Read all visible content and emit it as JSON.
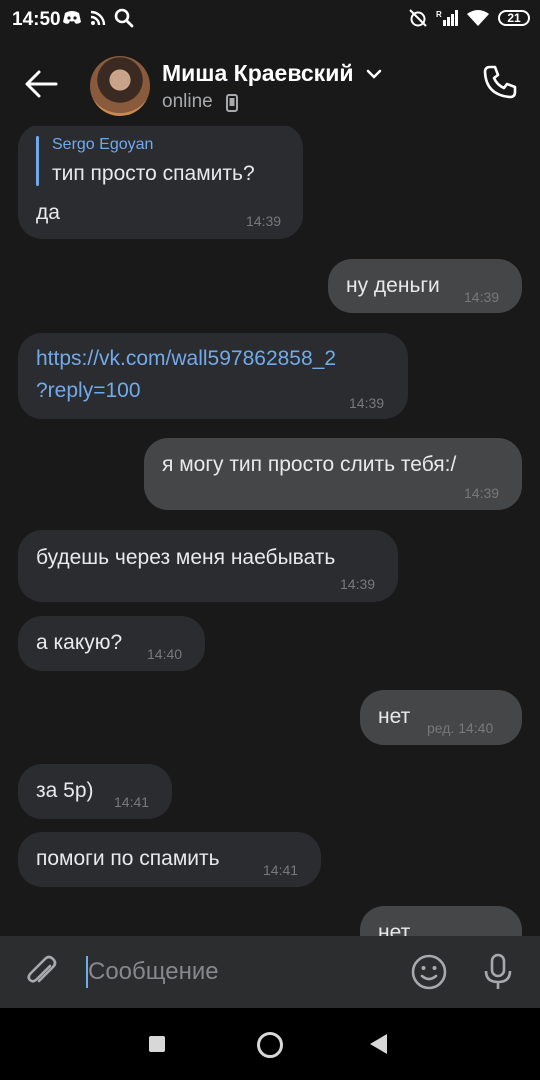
{
  "status_bar": {
    "time": "14:50",
    "battery": "21",
    "signal_label": "R"
  },
  "header": {
    "contact_name": "Миша Краевский",
    "status": "online"
  },
  "messages": [
    {
      "side": "in",
      "reply_author": "Sergo Egoyan",
      "reply_text": "тип просто спамить?",
      "text": "да",
      "time": "14:39"
    },
    {
      "side": "out",
      "text": "ну деньги",
      "time": "14:39"
    },
    {
      "side": "in",
      "text_line1": "https://vk.com/wall597862858_2",
      "text_line2": "?reply=100",
      "time": "14:39"
    },
    {
      "side": "out",
      "text": "я могу тип просто слить тебя:/",
      "time": "14:39"
    },
    {
      "side": "in",
      "text": "будешь через меня наебывать",
      "time": "14:39"
    },
    {
      "side": "in",
      "text": "а какую?",
      "time": "14:40"
    },
    {
      "side": "out",
      "text": "нет",
      "time": "ред. 14:40"
    },
    {
      "side": "in",
      "text": "за 5р)",
      "time": "14:41"
    },
    {
      "side": "in",
      "text": "помоги по спамить",
      "time": "14:41"
    },
    {
      "side": "out",
      "text": "нет",
      "time": ""
    }
  ],
  "composer": {
    "placeholder": "Сообщение"
  },
  "colors": {
    "accent": "#71aaeb",
    "bubble_in": "#2b2c2f",
    "bubble_out": "#454647",
    "background": "#19191a"
  },
  "icons": [
    "back-arrow-icon",
    "chevron-down-icon",
    "mobile-phone-icon",
    "call-icon",
    "attach-icon",
    "smile-icon",
    "mic-icon"
  ]
}
